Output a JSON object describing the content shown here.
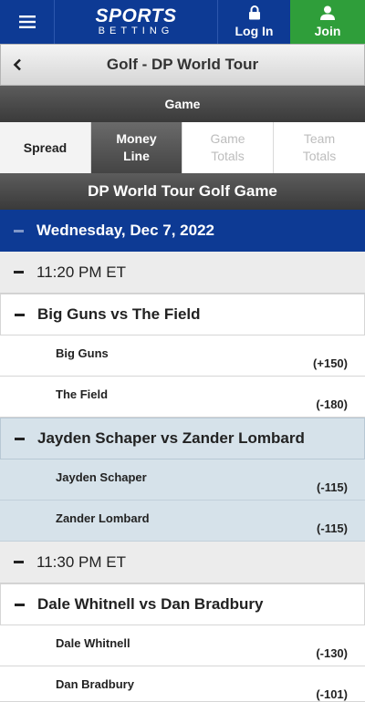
{
  "header": {
    "brand_main": "SPORTS",
    "brand_sub": "BETTING",
    "login_label": "Log In",
    "join_label": "Join",
    "colors": {
      "primary": "#0d3a94",
      "join": "#2f9e3a"
    },
    "icons": {
      "menu": "hamburger-menu-icon",
      "login": "lock-icon",
      "join": "user-icon"
    }
  },
  "page": {
    "title": "Golf - DP World Tour",
    "section": "Game"
  },
  "tabs": [
    {
      "label_1": "Spread",
      "label_2": ""
    },
    {
      "label_1": "Money",
      "label_2": "Line"
    },
    {
      "label_1": "Game",
      "label_2": "Totals"
    },
    {
      "label_1": "Team",
      "label_2": "Totals"
    }
  ],
  "game": {
    "heading": "DP World Tour Golf Game",
    "date": "Wednesday, Dec 7, 2022",
    "groups": [
      {
        "time": "11:20 PM ET",
        "matches": [
          {
            "title": "Big Guns vs The Field",
            "selections": [
              {
                "name": "Big Guns",
                "odds": "(+150)"
              },
              {
                "name": "The Field",
                "odds": "(-180)"
              }
            ]
          },
          {
            "title": "Jayden Schaper vs Zander Lombard",
            "selections": [
              {
                "name": "Jayden Schaper",
                "odds": "(-115)"
              },
              {
                "name": "Zander Lombard",
                "odds": "(-115)"
              }
            ]
          }
        ]
      },
      {
        "time": "11:30 PM ET",
        "matches": [
          {
            "title": "Dale Whitnell vs Dan Bradbury",
            "selections": [
              {
                "name": "Dale Whitnell",
                "odds": "(-130)"
              },
              {
                "name": "Dan Bradbury",
                "odds": "(-101)"
              }
            ]
          }
        ]
      }
    ]
  }
}
